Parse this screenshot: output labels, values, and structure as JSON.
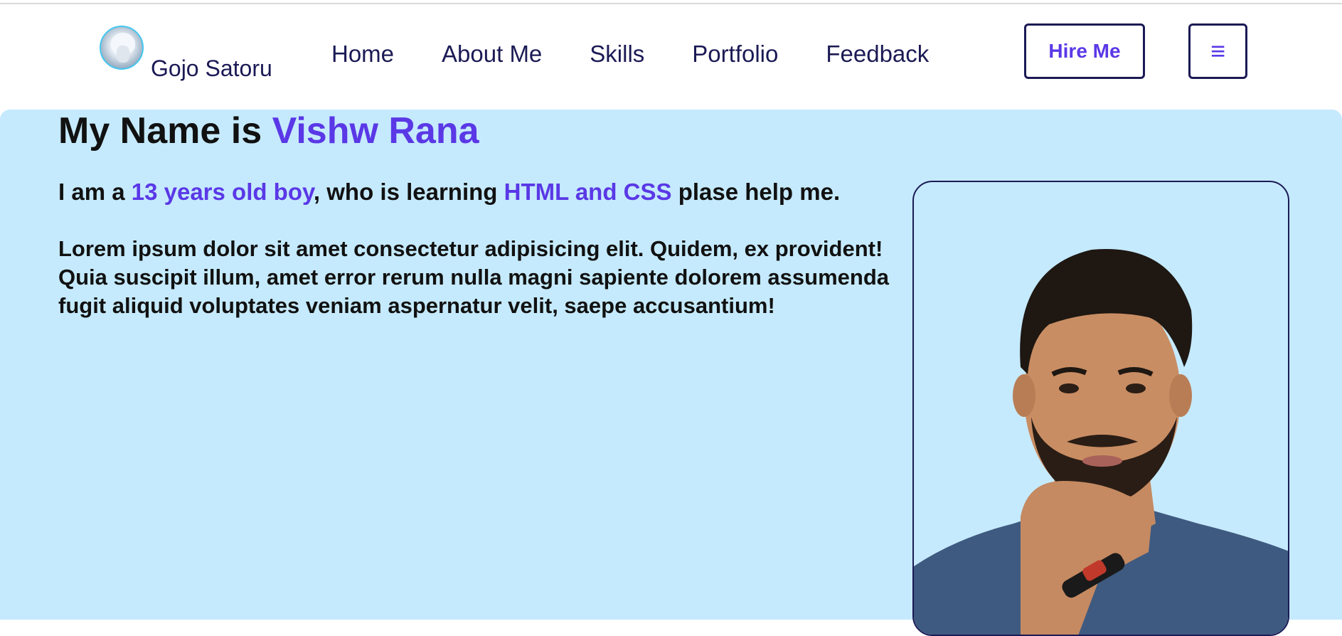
{
  "header": {
    "brand_name": "Gojo Satoru",
    "nav": [
      {
        "label": "Home"
      },
      {
        "label": "About Me"
      },
      {
        "label": "Skills"
      },
      {
        "label": "Portfolio"
      },
      {
        "label": "Feedback"
      }
    ],
    "hire_button": "Hire Me",
    "menu_icon": "≡"
  },
  "hero": {
    "title_prefix": "My Name is ",
    "title_name": "Vishw Rana",
    "intro": {
      "part1": "I am a ",
      "highlight1": "13 years old boy",
      "part2": ", who is learning ",
      "highlight2": "HTML and CSS",
      "part3": " plase help me."
    },
    "paragraph": "Lorem ipsum dolor sit amet consectetur adipisicing elit. Quidem, ex provident! Quia suscipit illum, amet error rerum nulla magni sapiente dolorem assumenda fugit aliquid voluptates veniam aspernatur velit, saepe accusantium!"
  },
  "colors": {
    "accent": "#5a38e6",
    "navy": "#1b1a55",
    "hero_bg": "#c5eafd"
  },
  "icons": {
    "menu": "hamburger-menu-icon",
    "logo": "avatar-logo"
  }
}
